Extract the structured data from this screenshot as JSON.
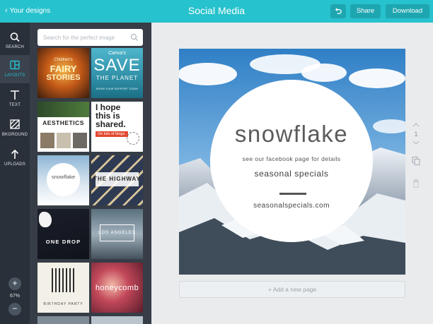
{
  "topbar": {
    "back_label": "Your designs",
    "title": "Social Media",
    "share_label": "Share",
    "download_label": "Download",
    "accent_color": "#26c2cd"
  },
  "rail": {
    "items": [
      {
        "label": "SEARCH",
        "icon": "search-icon"
      },
      {
        "label": "LAYOUTS",
        "icon": "layouts-icon"
      },
      {
        "label": "TEXT",
        "icon": "text-icon"
      },
      {
        "label": "BKGROUND",
        "icon": "background-icon"
      },
      {
        "label": "UPLOADS",
        "icon": "upload-icon"
      }
    ],
    "active": "LAYOUTS",
    "zoom_level": "67%"
  },
  "panel": {
    "search_placeholder": "Search for the perfect image",
    "templates": [
      {
        "name": "fairy-stories",
        "lines": [
          "Children's",
          "FAIRY",
          "STORIES"
        ]
      },
      {
        "name": "save-the-planet",
        "lines": [
          "Canva's",
          "SAVE",
          "THE PLANET",
          "SHOW YOUR SUPPORT TODAY"
        ]
      },
      {
        "name": "aesthetics",
        "lines": [
          "AESTHETICS"
        ]
      },
      {
        "name": "i-hope-this-is-shared",
        "lines": [
          "I hope",
          "this is",
          "shared.",
          "On lots of blogs."
        ]
      },
      {
        "name": "snowflake-mini",
        "lines": [
          "snowflake"
        ]
      },
      {
        "name": "the-highway",
        "lines": [
          "THE HIGHWAY"
        ]
      },
      {
        "name": "one-drop",
        "lines": [
          "ONE DROP"
        ]
      },
      {
        "name": "los-angeles",
        "lines": [
          "LOS ANGELES"
        ]
      },
      {
        "name": "birthday-party",
        "lines": [
          "BIRTHDAY PARTY"
        ]
      },
      {
        "name": "honeycomb",
        "lines": [
          "honeycomb"
        ]
      }
    ]
  },
  "design": {
    "headline": "snowflake",
    "line1": "see our facebook page for details",
    "line2": "seasonal specials",
    "url": "seasonalspecials.com"
  },
  "page_tools": {
    "page_number": "1"
  },
  "add_page_label": "+ Add a new page"
}
